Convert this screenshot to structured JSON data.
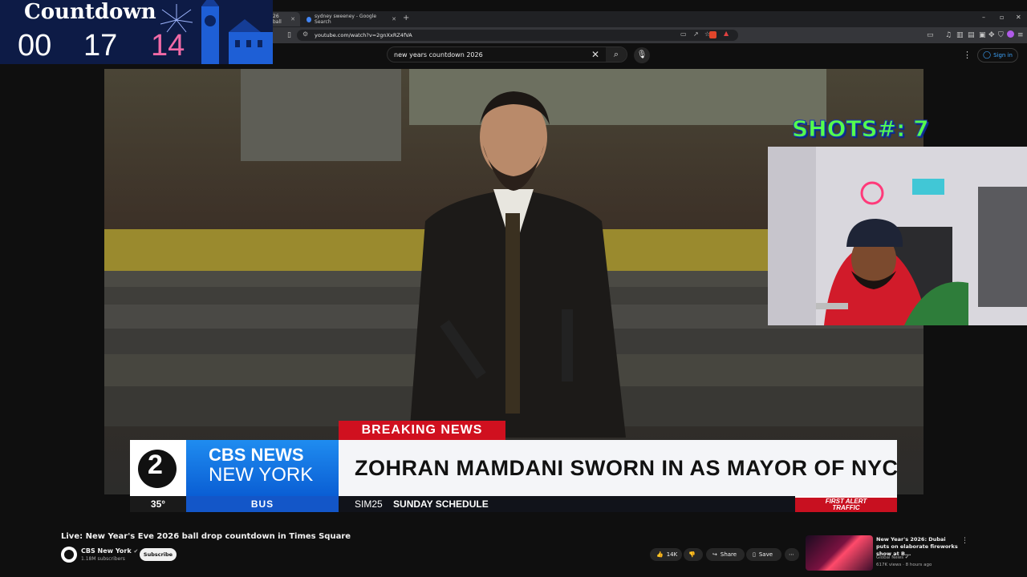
{
  "browser": {
    "tabs": [
      {
        "label": "26 ball",
        "active": true
      },
      {
        "label": "sydney sweeney - Google Search",
        "active": false
      }
    ],
    "url": "youtube.com/watch?v=2gnXxRZ4fVA",
    "new_tab": "+",
    "window_controls": [
      "–",
      "▫",
      "✕"
    ]
  },
  "youtube": {
    "search_query": "new years countdown 2026",
    "sign_in_label": "Sign in"
  },
  "countdown": {
    "title": "Countdown",
    "hours": "00",
    "minutes": "17",
    "seconds": "14"
  },
  "shots_counter": "SHOTS#: 7",
  "broadcast": {
    "banner": "BREAKING NEWS",
    "headline": "ZOHRAN MAMDANI SWORN IN AS MAYOR OF NYC",
    "station_number": "2",
    "brand_line1": "CBS NEWS",
    "brand_line2": "NEW YORK",
    "temperature": "35°",
    "ticker_category": "BUS",
    "ticker_route": "SIM25",
    "ticker_text": "SUNDAY SCHEDULE",
    "first_alert_line1": "FIRST ALERT",
    "first_alert_line2": "TRAFFIC"
  },
  "video_info": {
    "title": "Live: New Year's Eve 2026 ball drop countdown in Times Square",
    "channel": "CBS New York",
    "subscribers": "1.18M subscribers",
    "subscribe_label": "Subscribe",
    "likes": "14K",
    "share_label": "Share",
    "save_label": "Save"
  },
  "recommendation": {
    "title": "New Year's 2026: Dubai puts on elaborate fireworks show at B...",
    "channel": "Global News",
    "meta": "617K views · 8 hours ago"
  },
  "colors": {
    "cbs_blue": "#1f8cf0",
    "breaking_red": "#d0101f",
    "shots_green": "#55ff4c",
    "countdown_pink": "#f06aa6",
    "yt_link_blue": "#3ea6ff"
  }
}
